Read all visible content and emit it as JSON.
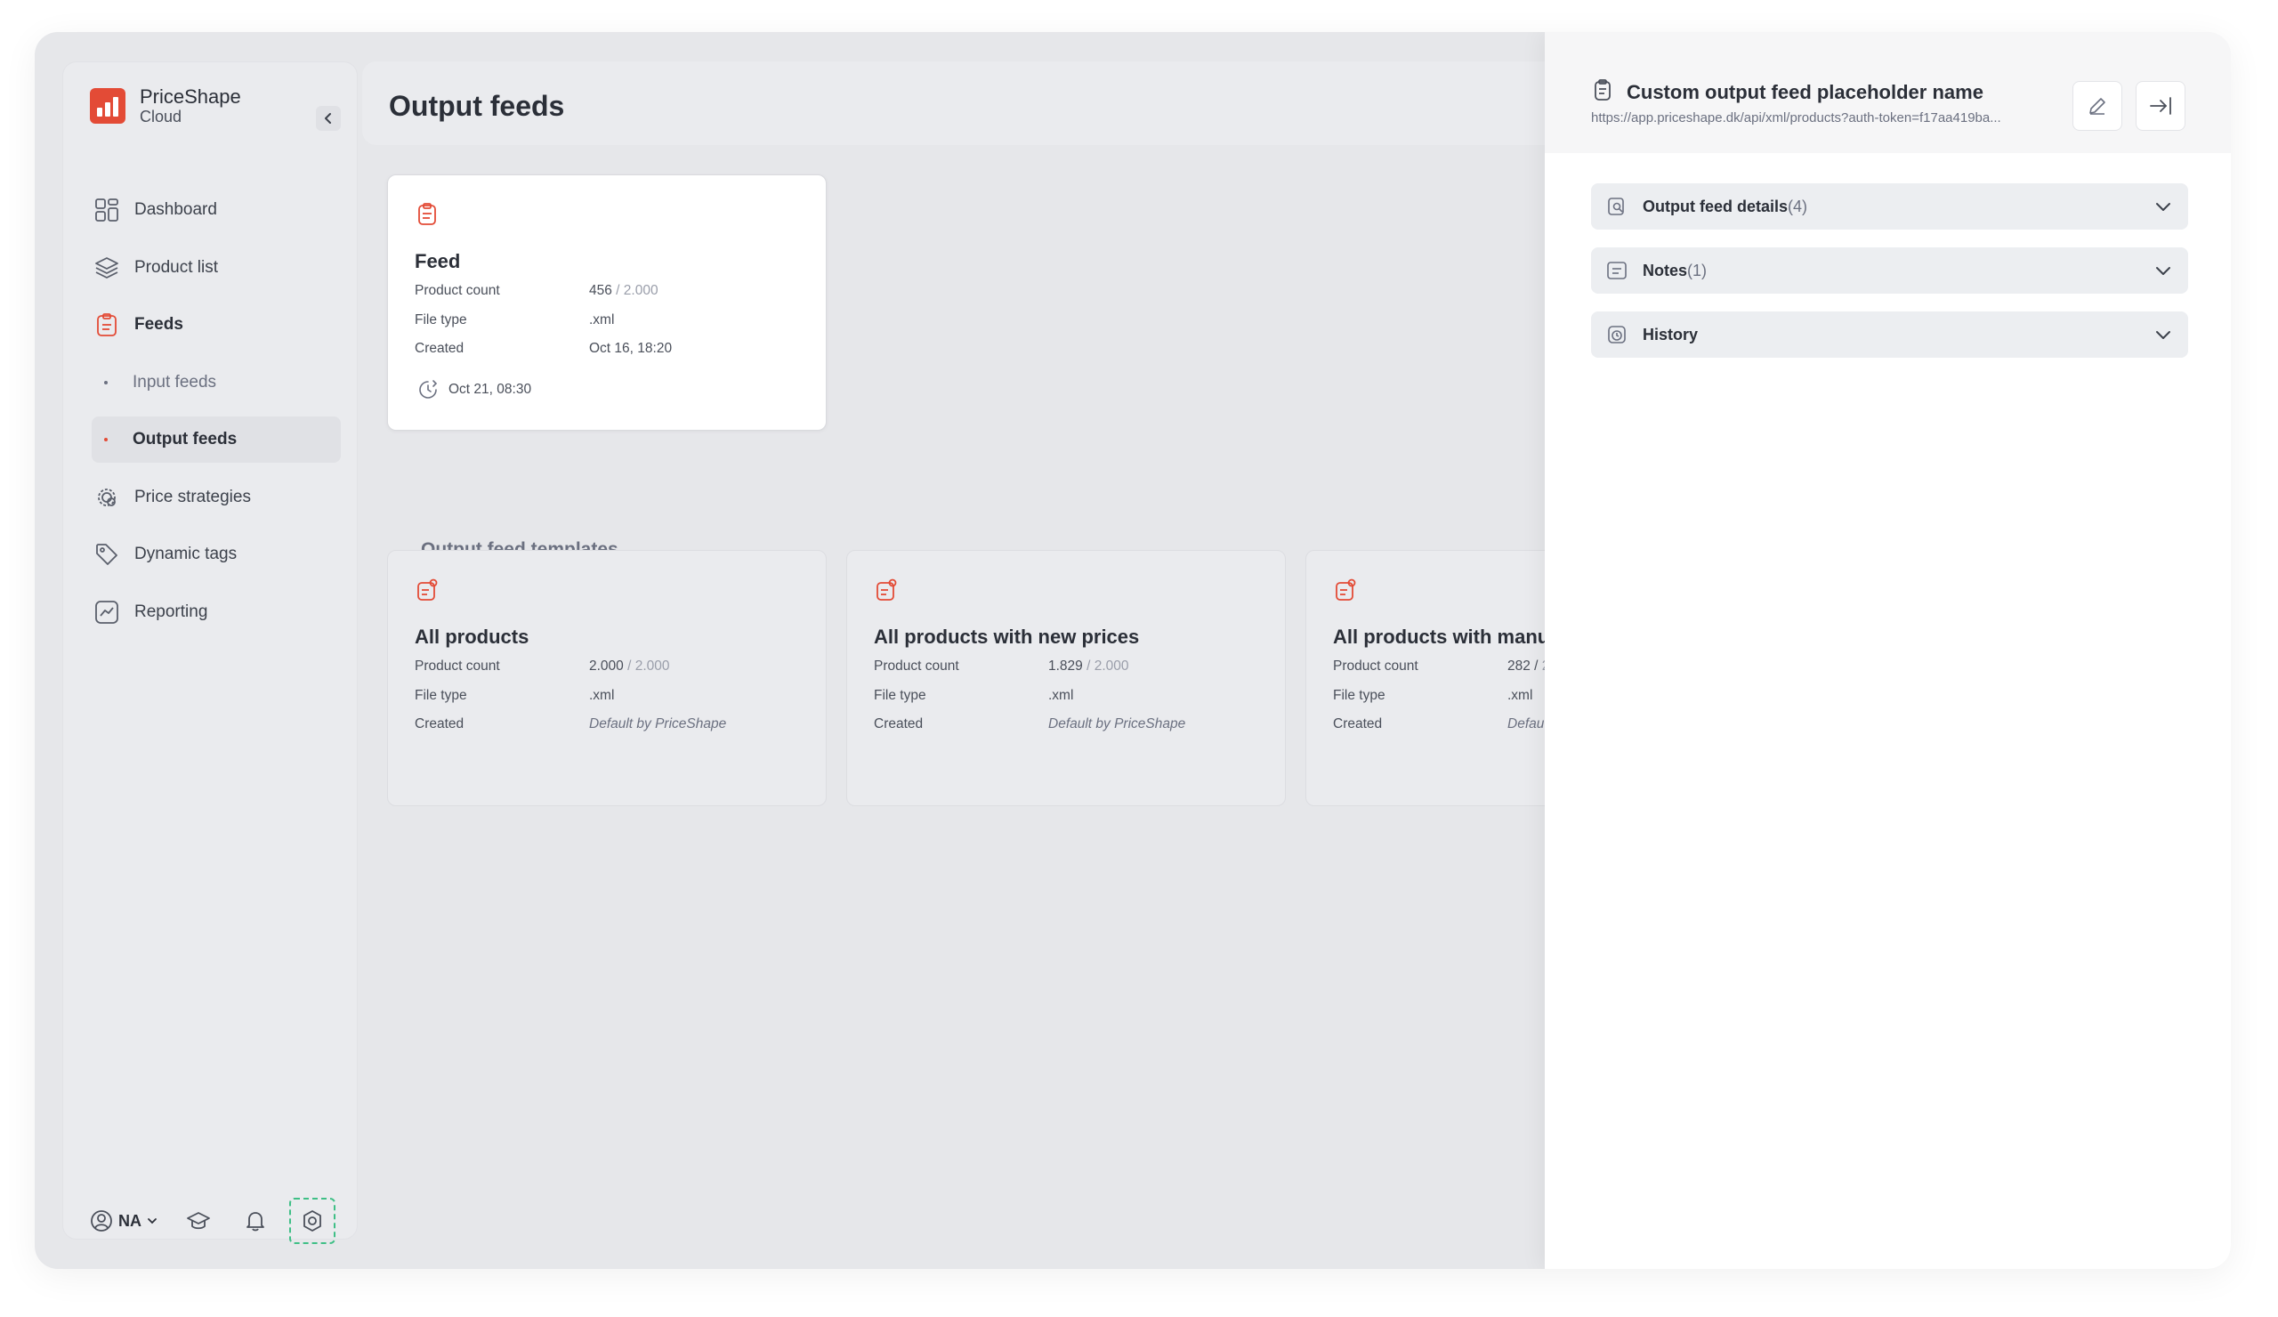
{
  "brand": {
    "name": "PriceShape",
    "sub": "Cloud",
    "color": "#e34b36"
  },
  "nav": {
    "dashboard": "Dashboard",
    "product_list": "Product list",
    "feeds": "Feeds",
    "input_feeds": "Input feeds",
    "output_feeds": "Output feeds",
    "price_strategies": "Price strategies",
    "dynamic_tags": "Dynamic tags",
    "reporting": "Reporting"
  },
  "footer": {
    "user_initials": "NA"
  },
  "main": {
    "title": "Output feeds",
    "feed": {
      "title": "Feed",
      "product_count_label": "Product count",
      "product_count": "456",
      "product_count_total": " / 2.000",
      "file_type_label": "File type",
      "file_type": ".xml",
      "created_label": "Created",
      "created": "Oct 16, 18:20",
      "synced": "Oct 21, 08:30"
    },
    "templates_title": "Output feed templates",
    "templates": [
      {
        "title": "All products",
        "product_count_label": "Product count",
        "product_count": "2.000",
        "product_count_total": " / 2.000",
        "file_type_label": "File type",
        "file_type": ".xml",
        "created_label": "Created",
        "created": "Default by PriceShape"
      },
      {
        "title": "All products with new prices",
        "product_count_label": "Product count",
        "product_count": "1.829",
        "product_count_total": " / 2.000",
        "file_type_label": "File type",
        "file_type": ".xml",
        "created_label": "Created",
        "created": "Default by PriceShape"
      },
      {
        "title": "All products with manu",
        "product_count_label": "Product count",
        "product_count": "282 / ",
        "product_count_total": "2",
        "file_type_label": "File type",
        "file_type": ".xml",
        "created_label": "Created",
        "created": "Defau"
      }
    ]
  },
  "panel": {
    "title": "Custom output feed placeholder name",
    "url": "https://app.priceshape.dk/api/xml/products?auth-token=f17aa419ba...",
    "sections": [
      {
        "label": "Output feed details",
        "count": "(4)"
      },
      {
        "label": "Notes",
        "count": " (1)"
      },
      {
        "label": "History",
        "count": ""
      }
    ]
  },
  "colors": {
    "accent": "#e34b36",
    "settings_outline": "#3fbf86"
  }
}
